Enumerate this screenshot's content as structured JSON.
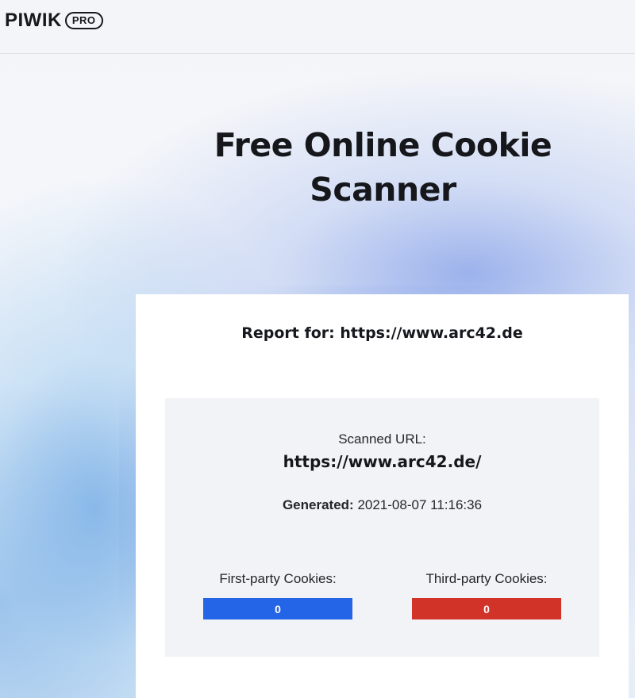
{
  "brand": {
    "name": "PIWIK",
    "suffix": "PRO"
  },
  "hero": {
    "title_line1": "Free Online Cookie",
    "title_line2": "Scanner"
  },
  "report": {
    "title": "Report for: https://www.arc42.de",
    "scanned_label": "Scanned URL:",
    "scanned_url": "https://www.arc42.de/",
    "generated_label": "Generated:",
    "generated_value": "2021-08-07 11:16:36",
    "first_party": {
      "label": "First-party Cookies:",
      "count": "0",
      "color": "#2464e6"
    },
    "third_party": {
      "label": "Third-party Cookies:",
      "count": "0",
      "color": "#d23328"
    }
  }
}
